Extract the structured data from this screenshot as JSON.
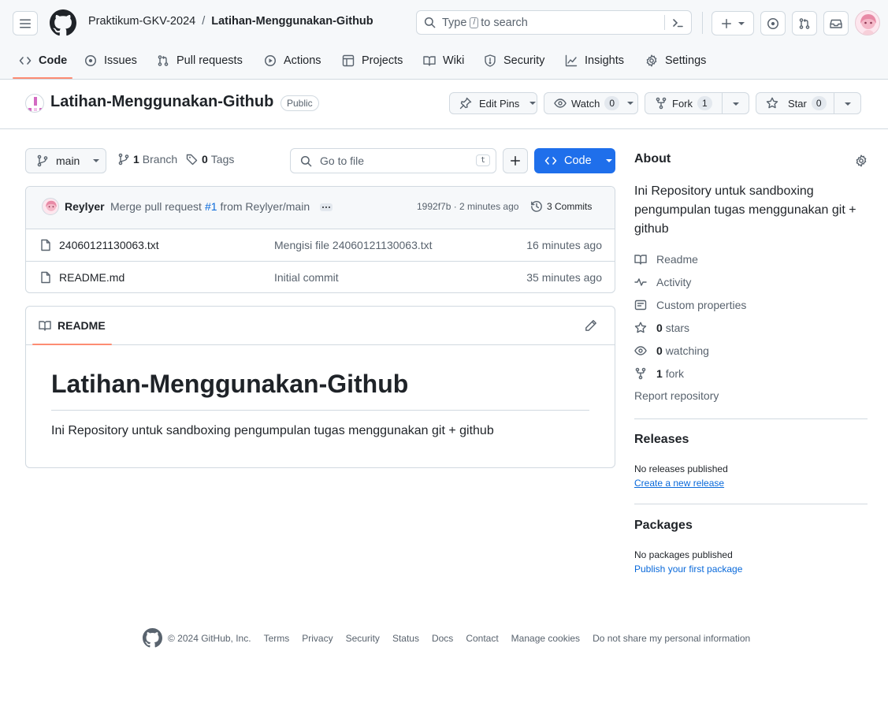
{
  "header": {
    "owner": "Praktikum-GKV-2024",
    "separator": "/",
    "repo": "Latihan-Menggunakan-Github",
    "search_prefix": "Type",
    "search_key": "/",
    "search_suffix": "to search"
  },
  "tabs": [
    {
      "label": "Code"
    },
    {
      "label": "Issues"
    },
    {
      "label": "Pull requests"
    },
    {
      "label": "Actions"
    },
    {
      "label": "Projects"
    },
    {
      "label": "Wiki"
    },
    {
      "label": "Security"
    },
    {
      "label": "Insights"
    },
    {
      "label": "Settings"
    }
  ],
  "repo_header": {
    "name": "Latihan-Menggunakan-Github",
    "visibility": "Public",
    "edit_pins": "Edit Pins",
    "watch_label": "Watch",
    "watch_count": "0",
    "fork_label": "Fork",
    "fork_count": "1",
    "star_label": "Star",
    "star_count": "0"
  },
  "toolbar": {
    "branch": "main",
    "branch_count": "1",
    "branch_label": "Branch",
    "tag_count": "0",
    "tag_label": "Tags",
    "goto_placeholder": "Go to file",
    "goto_key": "t",
    "add_label": "+",
    "code_label": "Code"
  },
  "commit": {
    "author": "Reylyer",
    "message_pre": "Merge pull request",
    "pr": "#1",
    "message_post": "from Reylyer/main",
    "hash_time": "1992f7b · 2 minutes ago",
    "commits": "3 Commits"
  },
  "files": [
    {
      "name": "24060121130063.txt",
      "message": "Mengisi file 24060121130063.txt",
      "time": "16 minutes ago"
    },
    {
      "name": "README.md",
      "message": "Initial commit",
      "time": "35 minutes ago"
    }
  ],
  "readme": {
    "tab": "README",
    "title": "Latihan-Menggunakan-Github",
    "body": "Ini Repository untuk sandboxing pengumpulan tugas menggunakan git + github"
  },
  "about": {
    "heading": "About",
    "description": "Ini Repository untuk sandboxing pengumpulan tugas menggunakan git + github",
    "readme": "Readme",
    "activity": "Activity",
    "custom_properties": "Custom properties",
    "stars_count": "0",
    "stars_label": "stars",
    "watching_count": "0",
    "watching_label": "watching",
    "fork_count": "1",
    "fork_label": "fork",
    "report": "Report repository"
  },
  "releases": {
    "heading": "Releases",
    "none": "No releases published",
    "create": "Create a new release"
  },
  "packages": {
    "heading": "Packages",
    "none": "No packages published",
    "publish": "Publish your first package"
  },
  "footer": {
    "copyright": "© 2024 GitHub, Inc.",
    "links": [
      "Terms",
      "Privacy",
      "Security",
      "Status",
      "Docs",
      "Contact",
      "Manage cookies",
      "Do not share my personal information"
    ]
  },
  "colors": {
    "accent": "#0969da",
    "primary_button": "#1f6feb",
    "tab_underline": "#fd8c73"
  }
}
